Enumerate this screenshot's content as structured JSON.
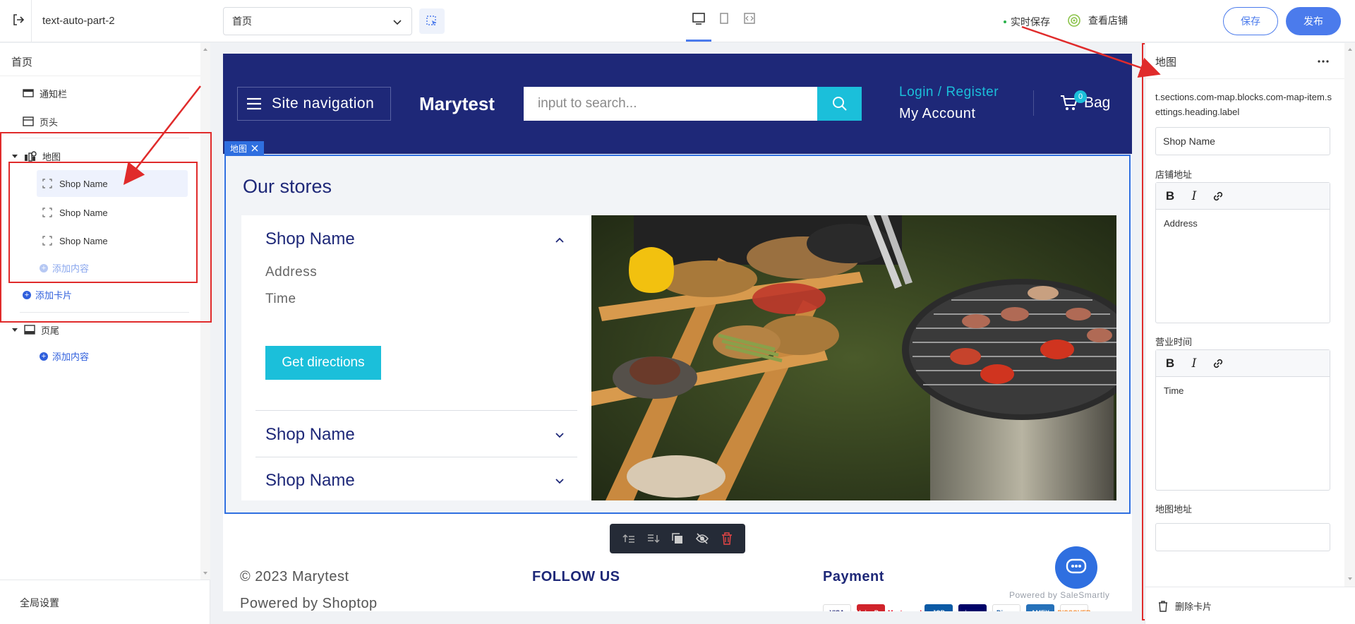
{
  "topbar": {
    "shop_name": "text-auto-part-2",
    "page_select": "首页",
    "autosave": "实时保存",
    "view_store": "查看店铺",
    "save": "保存",
    "publish": "发布"
  },
  "sidebar": {
    "title": "首页",
    "items": [
      {
        "label": "通知栏",
        "icon": "announcement-bar-icon"
      },
      {
        "label": "页头",
        "icon": "header-icon"
      },
      {
        "label": "地图",
        "icon": "map-icon"
      }
    ],
    "map_children": [
      "Shop Name",
      "Shop Name",
      "Shop Name"
    ],
    "add_content": "添加内容",
    "add_card": "添加卡片",
    "footer_label": "页尾",
    "footer_add_content": "添加内容",
    "global_settings": "全局设置"
  },
  "site": {
    "nav_label": "Site navigation",
    "brand": "Marytest",
    "search_placeholder": "input to search...",
    "login": "Login / Register",
    "account": "My Account",
    "bag": "Bag",
    "bag_count": "0"
  },
  "section": {
    "tag": "地图",
    "title": "Our stores",
    "stores": [
      {
        "name": "Shop Name",
        "expanded": true,
        "address": "Address",
        "time": "Time",
        "button": "Get directions"
      },
      {
        "name": "Shop Name",
        "expanded": false
      },
      {
        "name": "Shop Name",
        "expanded": false
      }
    ],
    "image": "grilled-food-barbecue-photo"
  },
  "footer": {
    "copyright": "© 2023 Marytest",
    "powered": "Powered by Shoptop",
    "follow": "FOLLOW US",
    "payment": "Payment",
    "payment_cards": [
      "VISA",
      "UnionPay",
      "Mastercard",
      "JCB",
      "giropay",
      "Diners",
      "AMEX",
      "DISCOVER"
    ],
    "chat_brand": "Powered by SaleSmartly"
  },
  "right_panel": {
    "title": "地图",
    "heading_label": "t.sections.com-map.blocks.com-map-item.settings.heading.label",
    "heading_value": "Shop Name",
    "address_label": "店铺地址",
    "address_value": "Address",
    "hours_label": "营业时间",
    "hours_value": "Time",
    "map_address_label": "地图地址",
    "map_address_value": "",
    "delete_card": "删除卡片"
  },
  "colors": {
    "accent": "#4b7bec",
    "site_header": "#1e2878",
    "cyan": "#1bbfda",
    "annotation": "#e02b2b"
  }
}
